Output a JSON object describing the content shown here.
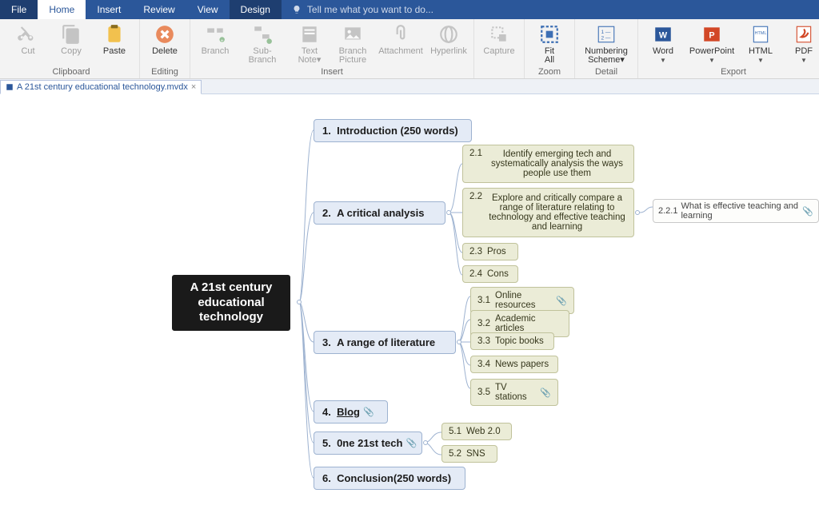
{
  "ribbon": {
    "tabs": [
      "File",
      "Home",
      "Insert",
      "Review",
      "View",
      "Design"
    ],
    "active_tab": 1,
    "search_placeholder": "Tell me what you want to do...",
    "groups": {
      "clipboard": {
        "title": "Clipboard",
        "cut": "Cut",
        "copy": "Copy",
        "paste": "Paste"
      },
      "editing": {
        "title": "Editing",
        "delete": "Delete"
      },
      "insert": {
        "title": "Insert",
        "branch": "Branch",
        "sub_branch": "Sub-Branch",
        "text_note": "Text\nNote▾",
        "branch_picture": "Branch\nPicture",
        "attachment": "Attachment",
        "hyperlink": "Hyperlink"
      },
      "capture": {
        "title": "",
        "capture": "Capture"
      },
      "zoom": {
        "title": "Zoom",
        "fit_all": "Fit\nAll"
      },
      "detail": {
        "title": "Detail",
        "numbering": "Numbering\nScheme▾"
      },
      "export": {
        "title": "Export",
        "word": "Word",
        "powerpoint": "PowerPoint",
        "html": "HTML",
        "pdf": "PDF"
      }
    }
  },
  "doc_tab": {
    "filename": "A 21st century educational technology.mvdx"
  },
  "mindmap": {
    "root": "A 21st century educational technology",
    "topics": {
      "t1": {
        "num": "1.",
        "text": "Introduction (250 words)"
      },
      "t2": {
        "num": "2.",
        "text": "A critical analysis"
      },
      "t3": {
        "num": "3.",
        "text": "A range of literature"
      },
      "t4": {
        "num": "4.",
        "text": "Blog"
      },
      "t5": {
        "num": "5.",
        "text": "0ne 21st tech"
      },
      "t6": {
        "num": "6.",
        "text": "Conclusion(250 words)"
      }
    },
    "subs": {
      "s21": {
        "sn": "2.1",
        "text": "Identify emerging tech and systematically analysis the ways people use them"
      },
      "s22": {
        "sn": "2.2",
        "text": "Explore and critically compare a range of literature relating to technology and effective teaching and learning"
      },
      "s23": {
        "sn": "2.3",
        "text": "Pros"
      },
      "s24": {
        "sn": "2.4",
        "text": "Cons"
      },
      "s31": {
        "sn": "3.1",
        "text": "Online resources"
      },
      "s32": {
        "sn": "3.2",
        "text": "Academic articles"
      },
      "s33": {
        "sn": "3.3",
        "text": "Topic books"
      },
      "s34": {
        "sn": "3.4",
        "text": "News papers"
      },
      "s35": {
        "sn": "3.5",
        "text": "TV stations"
      },
      "s51": {
        "sn": "5.1",
        "text": "Web 2.0"
      },
      "s52": {
        "sn": "5.2",
        "text": "SNS"
      }
    },
    "leaf": {
      "l221": {
        "sn": "2.2.1",
        "text": "What is effective teaching and learning"
      }
    }
  }
}
